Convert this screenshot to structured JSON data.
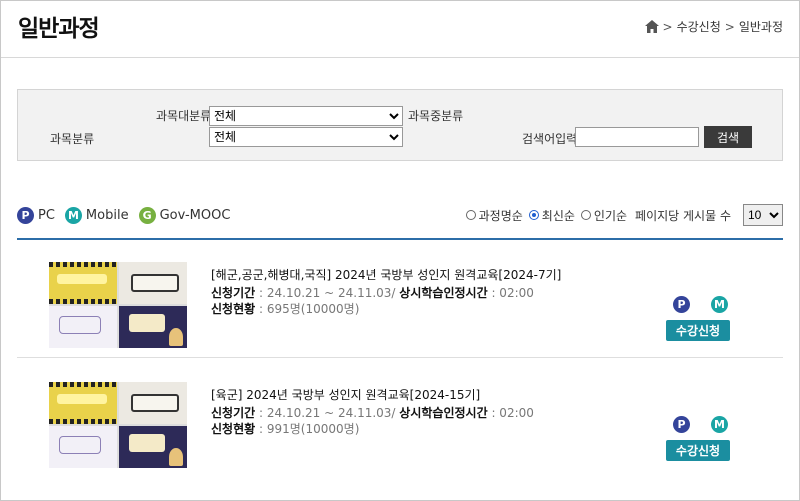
{
  "header": {
    "title": "일반과정",
    "breadcrumb": [
      "수강신청",
      "일반과정"
    ]
  },
  "search": {
    "category_label": "과목분류",
    "major_label": "과목대분류",
    "major_value": "전체",
    "middle_label": "과목중분류",
    "middle_value": "전체",
    "keyword_label": "검색어입력",
    "keyword_value": "",
    "button": "검색"
  },
  "legend": [
    {
      "badge": "P",
      "label": "PC",
      "color": "#34449a"
    },
    {
      "badge": "M",
      "label": "Mobile",
      "color": "#1aa5a5"
    },
    {
      "badge": "G",
      "label": "Gov-MOOC",
      "color": "#77b040"
    }
  ],
  "sort": {
    "options": [
      "과정명순",
      "최신순",
      "인기순"
    ],
    "selected": "최신순",
    "per_page_label": "페이지당 게시물 수",
    "per_page_value": "10"
  },
  "courses": [
    {
      "title": "[해군,공군,해병대,국직] 2024년 국방부 성인지 원격교육[2024-7기]",
      "period_label": "신청기간",
      "period_value": ": 24.10.21 ~ 24.11.03/",
      "hours_label": "상시학습인정시간",
      "hours_value": ": 02:00",
      "status_label": "신청현황",
      "status_value": ": 695명(10000명)",
      "platforms": [
        "P",
        "M"
      ],
      "button": "수강신청"
    },
    {
      "title": "[육군] 2024년 국방부 성인지 원격교육[2024-15기]",
      "period_label": "신청기간",
      "period_value": ": 24.10.21 ~ 24.11.03/",
      "hours_label": "상시학습인정시간",
      "hours_value": ": 02:00",
      "status_label": "신청현황",
      "status_value": ": 991명(10000명)",
      "platforms": [
        "P",
        "M"
      ],
      "button": "수강신청"
    }
  ],
  "colors": {
    "accent_line": "#2c6da8",
    "enroll_button": "#1b8ea0",
    "search_button": "#3a3a3a"
  }
}
